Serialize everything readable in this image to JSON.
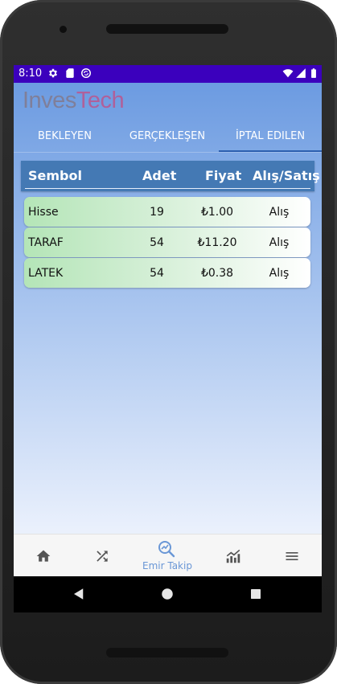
{
  "status_bar": {
    "time": "8:10",
    "left_icons": [
      "gear-icon",
      "sd-card-icon",
      "sync-icon"
    ],
    "right_icons": [
      "wifi-icon",
      "cell-signal-icon",
      "battery-icon"
    ],
    "background_color": "#3b00bd"
  },
  "app": {
    "logo_part1": "Inves",
    "logo_part2": "Tech",
    "logo_colors": [
      "#7f7f9a",
      "#b0609a"
    ]
  },
  "tabs": [
    {
      "label": "BEKLEYEN",
      "selected": false
    },
    {
      "label": "GERÇEKLEŞEN",
      "selected": false
    },
    {
      "label": "İPTAL EDILEN",
      "selected": true
    }
  ],
  "table": {
    "columns": [
      "Sembol",
      "Adet",
      "Fiyat",
      "Alış/Satış"
    ],
    "rows": [
      {
        "symbol": "Hisse",
        "quantity": "19",
        "price": "₺1.00",
        "side": "Alış"
      },
      {
        "symbol": "TARAF",
        "quantity": "54",
        "price": "₺11.20",
        "side": "Alış"
      },
      {
        "symbol": "LATEK",
        "quantity": "54",
        "price": "₺0.38",
        "side": "Alış"
      }
    ]
  },
  "bottom_nav": [
    {
      "icon": "home-icon",
      "label": ""
    },
    {
      "icon": "shuffle-icon",
      "label": ""
    },
    {
      "icon": "order-tracking-icon",
      "label": "Emir Takip",
      "active": true
    },
    {
      "icon": "chart-trend-icon",
      "label": ""
    },
    {
      "icon": "menu-icon",
      "label": ""
    }
  ],
  "colors": {
    "accent": "#4479b4",
    "active_nav": "#6a97d6",
    "row_gradient_start": "#b4e5b7"
  }
}
